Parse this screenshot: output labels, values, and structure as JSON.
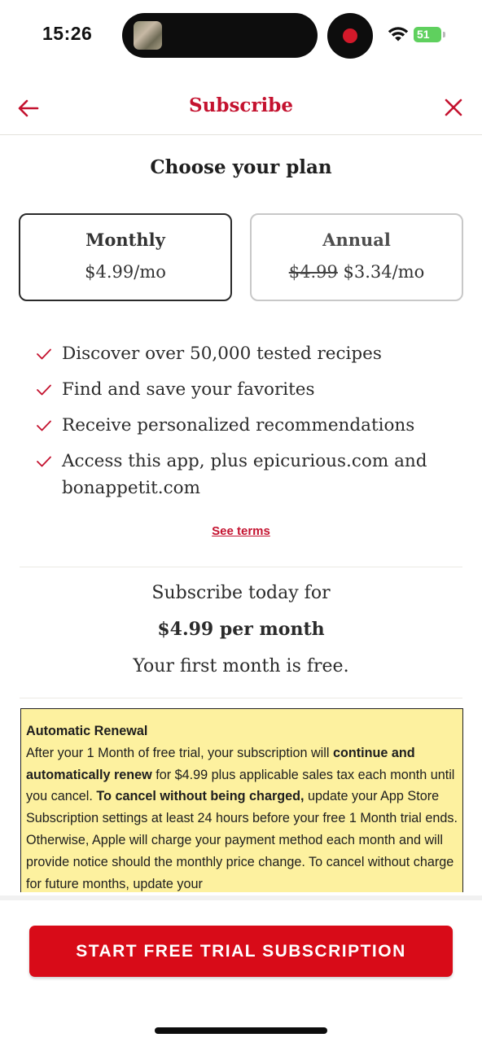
{
  "status_bar": {
    "time": "15:26",
    "battery_level": "51",
    "icons": [
      "app-thumbnail-icon",
      "record-icon",
      "wifi-icon",
      "battery-icon"
    ]
  },
  "nav": {
    "title": "Subscribe",
    "back_icon": "arrow-left-icon",
    "close_icon": "close-icon"
  },
  "heading": "Choose your plan",
  "plans": [
    {
      "name": "Monthly",
      "price": "$4.99/mo",
      "selected": true
    },
    {
      "name": "Annual",
      "original_price": "$4.99",
      "price": "$3.34/mo",
      "selected": false
    }
  ],
  "features": [
    "Discover over 50,000 tested recipes",
    "Find and save your favorites",
    "Receive personalized recommendations",
    "Access this app, plus epicurious.com and bonappetit.com"
  ],
  "see_terms": "See terms",
  "summary": {
    "line1": "Subscribe today for",
    "line2": "$4.99 per month",
    "line3": "Your first month is free."
  },
  "renewal": {
    "title": "Automatic Renewal",
    "p1": "After your 1 Month of free trial, your subscription will ",
    "b1": "continue and automatically renew",
    "p2": " for $4.99 plus applicable sales tax each month until you cancel. ",
    "b2": "To cancel without being charged,",
    "p3": " update your App Store Subscription settings at least 24 hours before your free 1 Month trial ends. Otherwise, Apple will charge your payment method each month and will provide notice should the monthly price change. To cancel without charge for future months, update your"
  },
  "cta_label": "START FREE TRIAL SUBSCRIPTION",
  "colors": {
    "brand_red": "#c4122f",
    "cta_red": "#d80b18",
    "notice_yellow": "#fdf19f",
    "battery_green": "#5fd05e"
  }
}
